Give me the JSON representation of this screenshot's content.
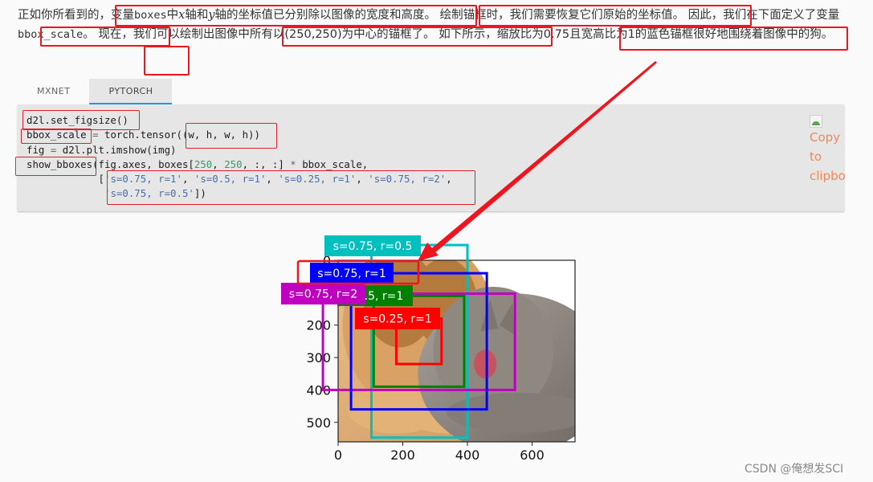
{
  "paragraph": {
    "segments": [
      {
        "text": "正如你所看到的，",
        "style": "plain"
      },
      {
        "text": "变量",
        "style": "plain"
      },
      {
        "text": "boxes",
        "style": "mono"
      },
      {
        "text": "中",
        "style": "plain"
      },
      {
        "text": "x",
        "style": "math"
      },
      {
        "text": "轴和",
        "style": "plain"
      },
      {
        "text": "y",
        "style": "math"
      },
      {
        "text": "轴的坐标值已分别除以图像的宽度和高度。",
        "style": "plain"
      },
      {
        "text": " 绘制锚框时，我们需要恢复它们原始的坐标值。",
        "style": "plain"
      },
      {
        "text": " 因此，我们在下面",
        "style": "plain"
      },
      {
        "text": "定义了变量",
        "style": "plain"
      },
      {
        "text": "bbox_scale",
        "style": "mono"
      },
      {
        "text": "。 现在，我们可以",
        "style": "plain"
      },
      {
        "text": "绘制出图像中所有以(250,250)为中心的锚框了。",
        "style": "plain"
      },
      {
        "text": " 如下所示，",
        "style": "plain"
      },
      {
        "text": "缩放比为0.75且宽高比为1的蓝色锚框很好地围绕着图像中的狗。",
        "style": "plain"
      }
    ]
  },
  "tabs": [
    {
      "label": "MXNET",
      "active": false
    },
    {
      "label": "PYTORCH",
      "active": true
    }
  ],
  "code": {
    "lines": [
      [
        {
          "t": "d2l.set_figsize()",
          "c": ""
        }
      ],
      [
        {
          "t": "bbox_scale ",
          "c": ""
        },
        {
          "t": "=",
          "c": "op"
        },
        {
          "t": " torch.tensor((w, h, w, h))",
          "c": ""
        }
      ],
      [
        {
          "t": "fig ",
          "c": ""
        },
        {
          "t": "=",
          "c": "op"
        },
        {
          "t": " d2l.plt.imshow(img)",
          "c": ""
        }
      ],
      [
        {
          "t": "show_bboxes(fig.axes, boxes[",
          "c": ""
        },
        {
          "t": "250",
          "c": "num"
        },
        {
          "t": ", ",
          "c": ""
        },
        {
          "t": "250",
          "c": "num"
        },
        {
          "t": ", :, :] ",
          "c": ""
        },
        {
          "t": "*",
          "c": "op"
        },
        {
          "t": " bbox_scale,",
          "c": ""
        }
      ],
      [
        {
          "t": "            [",
          "c": ""
        },
        {
          "t": "'s=0.75, r=1'",
          "c": "str"
        },
        {
          "t": ", ",
          "c": ""
        },
        {
          "t": "'s=0.5, r=1'",
          "c": "str"
        },
        {
          "t": ", ",
          "c": ""
        },
        {
          "t": "'s=0.25, r=1'",
          "c": "str"
        },
        {
          "t": ", ",
          "c": ""
        },
        {
          "t": "'s=0.75, r=2'",
          "c": "str"
        },
        {
          "t": ",",
          "c": ""
        }
      ],
      [
        {
          "t": "             ",
          "c": ""
        },
        {
          "t": "'s=0.75, r=0.5'",
          "c": "str"
        },
        {
          "t": "])",
          "c": ""
        }
      ]
    ],
    "copy_button": {
      "icon": "broken-image-icon",
      "label": "Copy to clipboard",
      "visible_text": [
        "Copy",
        "to",
        "clipbo"
      ]
    }
  },
  "figure": {
    "x_ticks": [
      "0",
      "200",
      "400",
      "600"
    ],
    "y_ticks": [
      "0",
      "200",
      "300",
      "400",
      "500"
    ],
    "image_description": "puppy and kitten on white background",
    "boxes": [
      {
        "label": "s=0.75, r=1",
        "color": "#0000ff",
        "xmin": 40,
        "ymin": 40,
        "xmax": 460,
        "ymax": 460
      },
      {
        "label": "s=0.5, r=1",
        "color": "#008000",
        "xmin": 110,
        "ymin": 110,
        "xmax": 390,
        "ymax": 390
      },
      {
        "label": "s=0.25, r=1",
        "color": "#ff0000",
        "xmin": 180,
        "ymin": 180,
        "xmax": 320,
        "ymax": 320
      },
      {
        "label": "s=0.75, r=2",
        "color": "#bf00bf",
        "xmin": -47,
        "ymin": 103,
        "xmax": 547,
        "ymax": 400
      },
      {
        "label": "s=0.75, r=0.5",
        "color": "#00bfbf",
        "xmin": 103,
        "ymin": -47,
        "xmax": 400,
        "ymax": 547
      }
    ]
  },
  "colors": {
    "annotation_red": "#f0141e",
    "copy_text": "#f4875a",
    "tab_underline": "#2196f3"
  },
  "watermark": "CSDN @俺想发SCI"
}
